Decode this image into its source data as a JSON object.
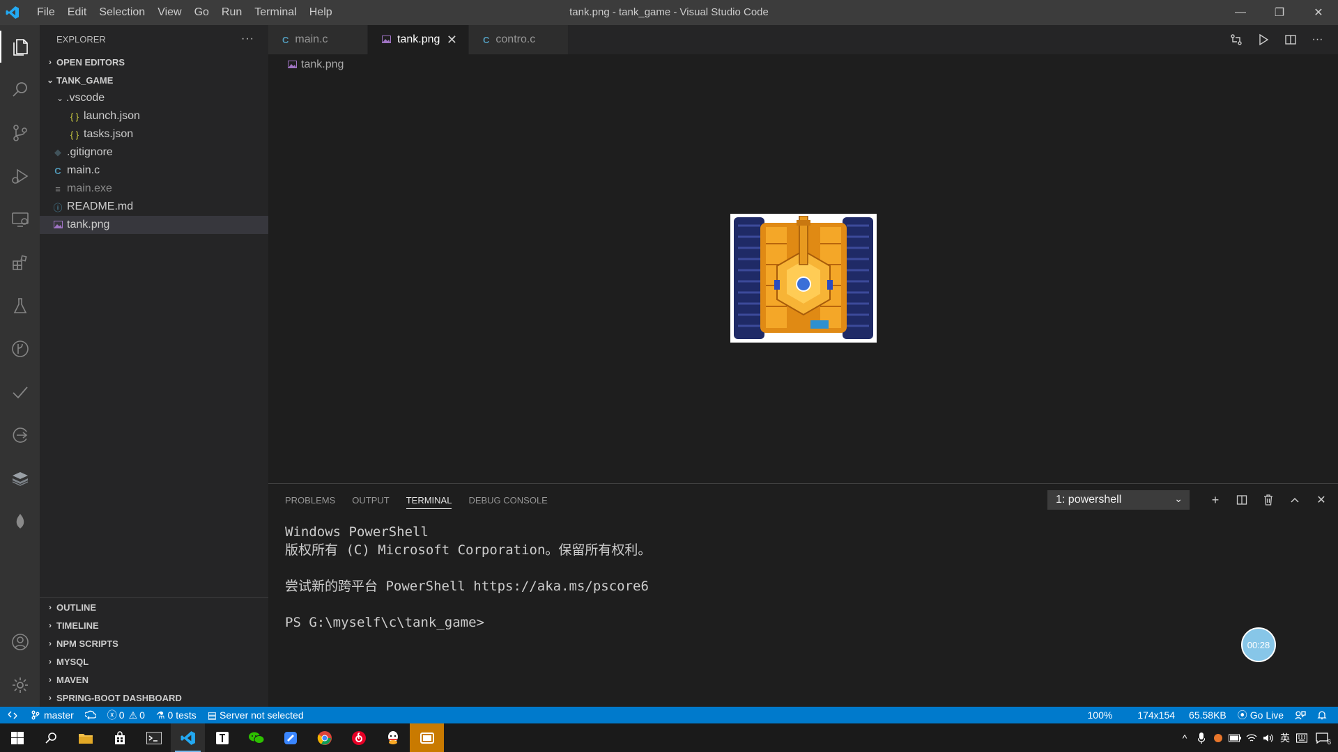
{
  "window": {
    "title": "tank.png - tank_game - Visual Studio Code",
    "menu": [
      "File",
      "Edit",
      "Selection",
      "View",
      "Go",
      "Run",
      "Terminal",
      "Help"
    ],
    "controls": {
      "minimize": "—",
      "restore": "❐",
      "close": "✕"
    }
  },
  "activitybar": {
    "items": [
      "explorer-icon",
      "search-icon",
      "source-control-icon",
      "run-debug-icon",
      "remote-explorer-icon",
      "extensions-icon",
      "testing-icon",
      "git-graph-icon",
      "todo-icon",
      "live-share-icon",
      "database-icon",
      "mongodb-leaf-icon"
    ],
    "bottom": [
      "account-icon",
      "settings-gear-icon"
    ]
  },
  "sidebar": {
    "header": "EXPLORER",
    "more": "···",
    "open_editors": "OPEN EDITORS",
    "root": "TANK_GAME",
    "tree": {
      "vscode": ".vscode",
      "launch": "launch.json",
      "tasks": "tasks.json",
      "gitignore": ".gitignore",
      "mainc": "main.c",
      "mainexe": "main.exe",
      "readme": "README.md",
      "tank": "tank.png"
    },
    "icons": {
      "json": "{ }",
      "c": "C",
      "info": "ⓘ",
      "exe": "≡",
      "git": "◆"
    },
    "bottom_sections": [
      "OUTLINE",
      "TIMELINE",
      "NPM SCRIPTS",
      "MYSQL",
      "MAVEN",
      "SPRING-BOOT DASHBOARD"
    ]
  },
  "tabs": {
    "items": [
      {
        "label": "main.c",
        "icon": "C"
      },
      {
        "label": "tank.png",
        "icon": "img"
      },
      {
        "label": "contro.c",
        "icon": "C"
      }
    ],
    "close": "✕"
  },
  "editor": {
    "breadcrumb": "tank.png"
  },
  "panel": {
    "tabs": [
      "PROBLEMS",
      "OUTPUT",
      "TERMINAL",
      "DEBUG CONSOLE"
    ],
    "terminal_select": "1: powershell",
    "dropdown": "⌄",
    "actions": {
      "add": "+",
      "split": "◫",
      "trash": "🗑",
      "maximize": "^",
      "close": "✕"
    },
    "terminal_lines": {
      "l1": "Windows PowerShell",
      "l2": "版权所有 (C) Microsoft Corporation。保留所有权利。",
      "l3": "尝试新的跨平台 PowerShell https://aka.ms/pscore6",
      "l4": "PS G:\\myself\\c\\tank_game>"
    },
    "timer": "00:28"
  },
  "statusbar": {
    "branch": "master",
    "errors": "0",
    "warnings": "0",
    "tests": "0 tests",
    "server": "Server not selected",
    "zoom": "100%",
    "dimensions": "174x154",
    "size": "65.58KB",
    "golive": "Go Live"
  },
  "taskbar": {
    "ime": "英",
    "notifications": "6"
  },
  "colors": {
    "accent": "#007acc",
    "tank_orange": "#f0a020",
    "tank_track": "#1f2a66"
  }
}
